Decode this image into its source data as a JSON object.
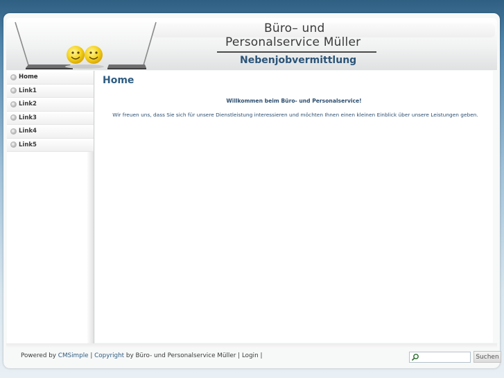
{
  "brand": {
    "line1": "Büro– und",
    "line2": "Personalservice Müller",
    "subtitle": "Nebenjobvermittlung"
  },
  "nav": {
    "items": [
      {
        "label": "Home"
      },
      {
        "label": "Link1"
      },
      {
        "label": "Link2"
      },
      {
        "label": "Link3"
      },
      {
        "label": "Link4"
      },
      {
        "label": "Link5"
      }
    ]
  },
  "content": {
    "title": "Home",
    "welcome": "Willkommen beim Büro- und Personalservice!",
    "intro": "Wir freuen uns, dass Sie sich für unsere Dienstleistung interessieren und möchten Ihnen einen kleinen Einblick über unsere Leistungen geben."
  },
  "footer": {
    "powered_prefix": "Powered by",
    "cms_link": "CMSimple",
    "sep1": "|",
    "copyright_link": "Copyright",
    "by_text": "by Büro- und Personalservice Müller",
    "sep2": "|",
    "login_link": "Login",
    "sep3": "|"
  },
  "search": {
    "placeholder": "",
    "button_label": "Suchen"
  },
  "colors": {
    "accent": "#2e5c80",
    "subtitle": "#2b5478",
    "smiley": "#f5d320"
  },
  "icons": {
    "laptop_left": "laptop-icon",
    "laptop_right": "laptop-icon",
    "smileys": "smiley-icon",
    "search": "search-icon",
    "nav_bullet": "bullet-icon"
  }
}
